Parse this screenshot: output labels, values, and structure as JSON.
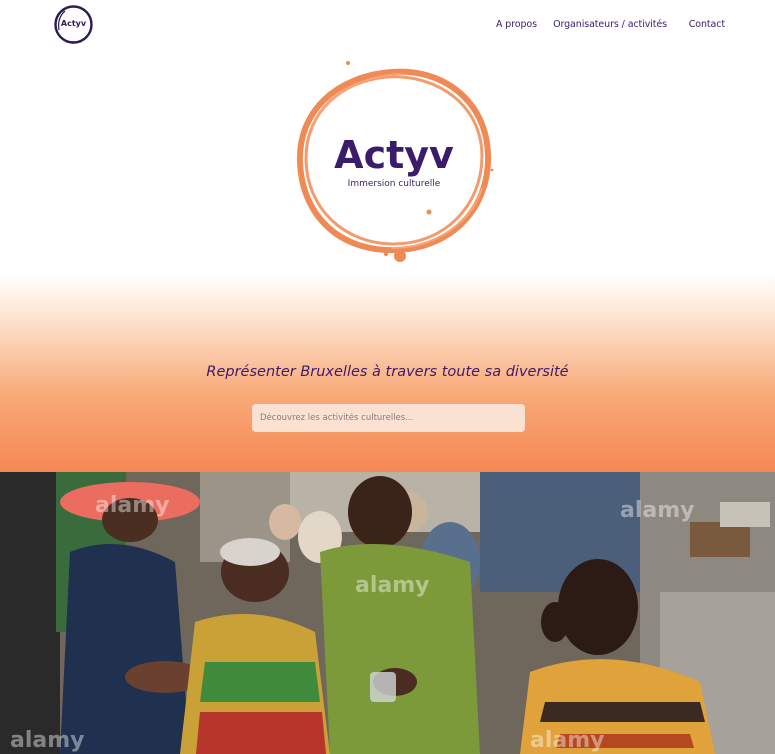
{
  "nav": {
    "logo_text": "Actyv",
    "links": [
      {
        "label": "A propos"
      },
      {
        "label": "Organisateurs / activités"
      },
      {
        "label": "Contact"
      }
    ]
  },
  "hero": {
    "logo_title": "Actyv",
    "logo_subtitle": "Immersion culturelle",
    "tagline": "Représenter Bruxelles à travers toute sa diversité",
    "search_placeholder": "Découvrez les activités culturelles..."
  },
  "photo": {
    "watermark": "alamy"
  },
  "colors": {
    "brand_purple": "#3b1c6b",
    "brand_orange": "#f08a55",
    "hero_gradient_end": "#f58753"
  }
}
